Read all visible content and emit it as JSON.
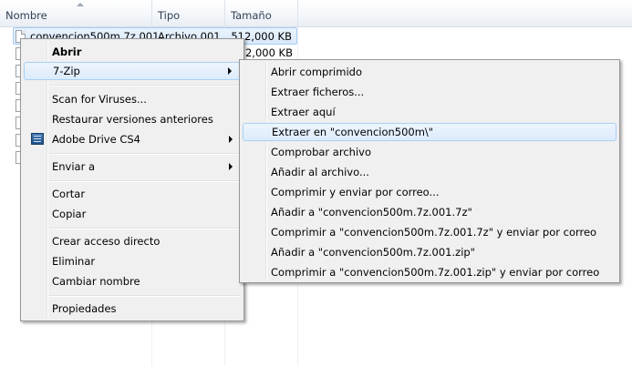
{
  "columns": {
    "name": "Nombre",
    "type": "Tipo",
    "size": "Tamaño"
  },
  "rows": [
    {
      "name": "convencion500m.7z.001",
      "type": "Archivo 001",
      "size": "512,000 KB"
    },
    {
      "size": "512,000 KB"
    }
  ],
  "context_menu": {
    "items": [
      "Abrir",
      "7-Zip",
      "Scan for Viruses...",
      "Restaurar versiones anteriores",
      "Adobe Drive CS4",
      "Enviar a",
      "Cortar",
      "Copiar",
      "Crear acceso directo",
      "Eliminar",
      "Cambiar nombre",
      "Propiedades"
    ]
  },
  "submenu_7zip": {
    "items": [
      "Abrir comprimido",
      "Extraer ficheros...",
      "Extraer aquí",
      "Extraer en \"convencion500m\\\"",
      "Comprobar archivo",
      "Añadir al archivo...",
      "Comprimir y enviar por correo...",
      "Añadir a \"convencion500m.7z.001.7z\"",
      "Comprimir a \"convencion500m.7z.001.7z\" y enviar por correo",
      "Añadir a \"convencion500m.7z.001.zip\"",
      "Comprimir a \"convencion500m.7z.001.zip\" y enviar por correo"
    ]
  },
  "icons": {
    "file": "file-icon",
    "adobe_drive": "adobe-drive-icon",
    "submenu_arrow": "chevron-right-icon",
    "sort": "sort-ascending-icon"
  },
  "colors": {
    "selection_border": "#a9cdf2",
    "menu_bg": "#f0f0f0",
    "highlight_border": "#a8d0f5"
  }
}
